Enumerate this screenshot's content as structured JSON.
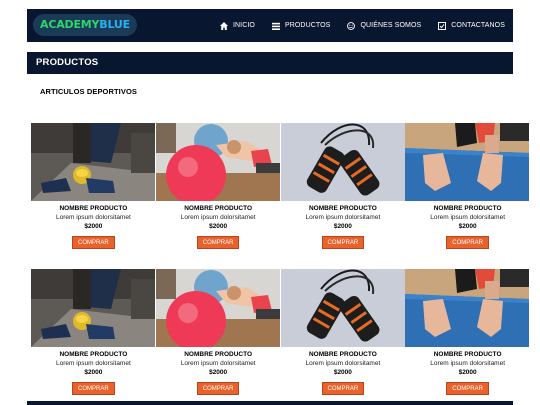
{
  "brand": {
    "part1": "ACADEMY",
    "part2": "BLUE"
  },
  "nav": [
    {
      "label": "INICIO",
      "icon": "home-icon"
    },
    {
      "label": "PRODUCTOS",
      "icon": "list-icon"
    },
    {
      "label": "QUIÉNES SOMOS",
      "icon": "smile-icon"
    },
    {
      "label": "CONTACTANOS",
      "icon": "checkbox-icon"
    }
  ],
  "section_title": "PRODUCTOS",
  "subtitle": "ARTICULOS DEPORTIVOS",
  "rows": [
    [
      {
        "image": "sneakers-medicine-ball-photo",
        "name": "NOMBRE PRODUCTO",
        "desc": "Lorem ipsum dolorsitamet",
        "price": "$2000",
        "button": "COMPRAR"
      },
      {
        "image": "pink-exercise-ball-photo",
        "name": "NOMBRE PRODUCTO",
        "desc": "Lorem ipsum dolorsitamet",
        "price": "$2000",
        "button": "COMPRAR"
      },
      {
        "image": "jump-rope-photo",
        "name": "NOMBRE PRODUCTO",
        "desc": "Lorem ipsum dolorsitamet",
        "price": "$2000",
        "button": "COMPRAR"
      },
      {
        "image": "yoga-mat-hands-photo",
        "name": "NOMBRE PRODUCTO",
        "desc": "Lorem ipsum dolorsitamet",
        "price": "$2000",
        "button": "COMPRAR"
      }
    ],
    [
      {
        "image": "sneakers-medicine-ball-photo",
        "name": "NOMBRE PRODUCTO",
        "desc": "Lorem ipsum dolorsitamet",
        "price": "$2000",
        "button": "COMPRAR"
      },
      {
        "image": "pink-exercise-ball-photo",
        "name": "NOMBRE PRODUCTO",
        "desc": "Lorem ipsum dolorsitamet",
        "price": "$2000",
        "button": "COMPRAR"
      },
      {
        "image": "jump-rope-photo",
        "name": "NOMBRE PRODUCTO",
        "desc": "Lorem ipsum dolorsitamet",
        "price": "$2000",
        "button": "COMPRAR"
      },
      {
        "image": "yoga-mat-hands-photo",
        "name": "NOMBRE PRODUCTO",
        "desc": "Lorem ipsum dolorsitamet",
        "price": "$2000",
        "button": "COMPRAR"
      }
    ]
  ],
  "colors": {
    "navy": "#08162f",
    "button": "#e9622c",
    "logo_green": "#2bd66b",
    "logo_blue": "#2ab0f0"
  }
}
